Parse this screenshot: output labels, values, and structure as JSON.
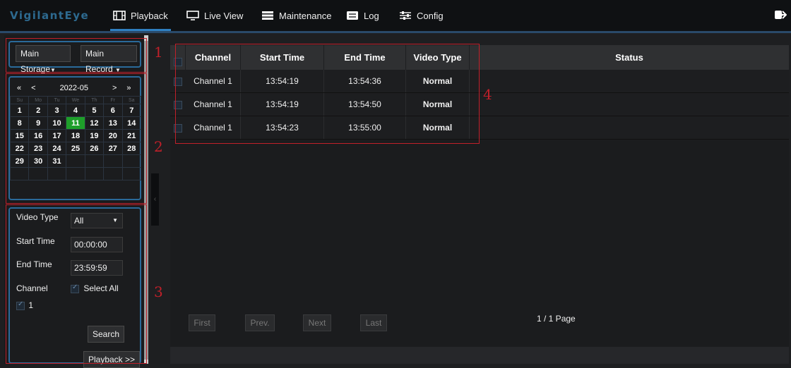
{
  "app": {
    "logo": "VigilantEye"
  },
  "nav": {
    "items": [
      {
        "label": "Playback",
        "icon": "film-icon",
        "active": true
      },
      {
        "label": "Live View",
        "icon": "monitor-icon",
        "active": false
      },
      {
        "label": "Maintenance",
        "icon": "server-icon",
        "active": false
      },
      {
        "label": "Log",
        "icon": "list-icon",
        "active": false
      },
      {
        "label": "Config",
        "icon": "sliders-icon",
        "active": false
      }
    ],
    "logout_icon": "logout-icon",
    "accent": "#2f7fc1"
  },
  "annotations": [
    "1",
    "2",
    "3",
    "4"
  ],
  "storage": {
    "storage_select": "Main Storage",
    "record_select": "Main Record"
  },
  "calendar": {
    "nav_prev_year": "«",
    "nav_prev_month": "<",
    "month": "2022-05",
    "nav_next_month": ">",
    "nav_next_year": "»",
    "weekdays": [
      "Su",
      "Mo",
      "Tu",
      "We",
      "Th",
      "Fr",
      "Sa"
    ],
    "weeks": [
      [
        "1",
        "2",
        "3",
        "4",
        "5",
        "6",
        "7"
      ],
      [
        "8",
        "9",
        "10",
        "11",
        "12",
        "13",
        "14"
      ],
      [
        "15",
        "16",
        "17",
        "18",
        "19",
        "20",
        "21"
      ],
      [
        "22",
        "23",
        "24",
        "25",
        "26",
        "27",
        "28"
      ],
      [
        "29",
        "30",
        "31",
        "",
        "",
        "",
        ""
      ],
      [
        "",
        "",
        "",
        "",
        "",
        "",
        ""
      ]
    ],
    "selected_day": "11",
    "selected_color": "#1e9e2a"
  },
  "search": {
    "video_type_label": "Video Type",
    "video_type_value": "All",
    "start_time_label": "Start Time",
    "start_time_value": "00:00:00",
    "end_time_label": "End Time",
    "end_time_value": "23:59:59",
    "channel_label": "Channel",
    "select_all_label": "Select All",
    "channel_option": "1",
    "search_button": "Search",
    "playback_button": "Playback >>"
  },
  "table": {
    "columns": [
      "Channel",
      "Start Time",
      "End Time",
      "Video Type",
      "Status"
    ],
    "rows": [
      {
        "channel": "Channel 1",
        "start": "13:54:19",
        "end": "13:54:36",
        "type": "Normal",
        "status": ""
      },
      {
        "channel": "Channel 1",
        "start": "13:54:19",
        "end": "13:54:50",
        "type": "Normal",
        "status": ""
      },
      {
        "channel": "Channel 1",
        "start": "13:54:23",
        "end": "13:55:00",
        "type": "Normal",
        "status": ""
      }
    ]
  },
  "pager": {
    "first": "First",
    "prev": "Prev.",
    "next": "Next",
    "last": "Last",
    "page_info": "1 / 1  Page"
  }
}
